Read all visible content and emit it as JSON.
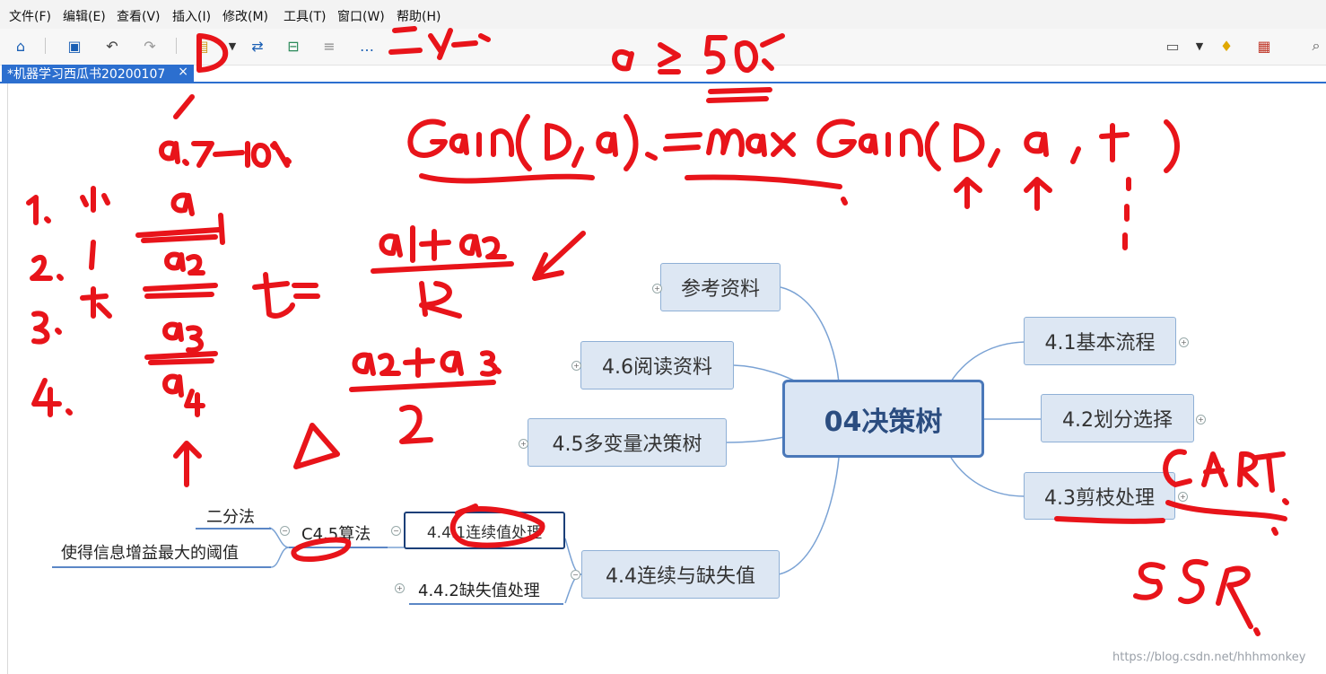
{
  "menu": [
    "文件(F)",
    "编辑(E)",
    "查看(V)",
    "插入(I)",
    "修改(M)",
    "工具(T)",
    "窗口(W)",
    "帮助(H)"
  ],
  "document_tab": {
    "title": "*机器学习西瓜书20200107",
    "close": "×"
  },
  "mindmap": {
    "center": "04决策树",
    "right_nodes": [
      "4.1基本流程",
      "4.2划分选择",
      "4.3剪枝处理"
    ],
    "left_nodes": [
      "参考资料",
      "4.6阅读资料",
      "4.5多变量决策树",
      "4.4连续与缺失值"
    ],
    "sub_nodes": [
      "4.4.1连续值处理",
      "4.4.2缺失值处理"
    ],
    "c45": "C4.5算法",
    "leaf_nodes": [
      "二分法",
      "使得信息增益最大的阈值"
    ]
  },
  "watermark": "https://blog.csdn.net/hhhmonkey",
  "annotation_color": "#e8141a",
  "node_colors": {
    "fill": "#dde7f3",
    "border": "#8fb0d6",
    "center_border": "#4a78b9",
    "line": "#7aa2d4"
  }
}
